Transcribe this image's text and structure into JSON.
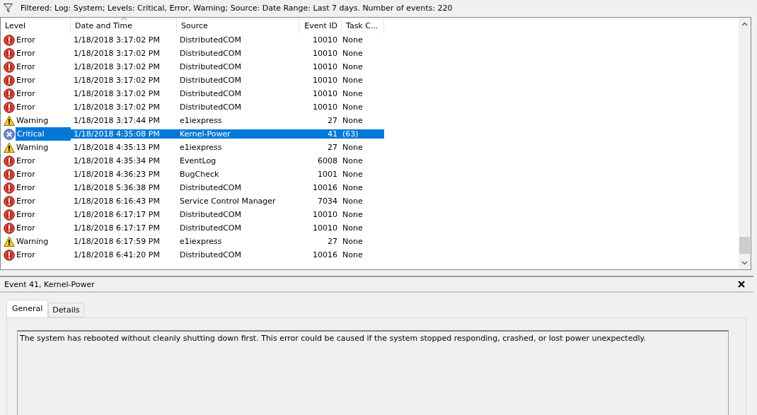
{
  "filter_bar": {
    "text": "Filtered: Log: System; Levels: Critical, Error, Warning; Source: Date Range: Last 7 days. Number of events: 220"
  },
  "table": {
    "columns": [
      {
        "label": "Level",
        "sorted": false
      },
      {
        "label": "Date and Time",
        "sorted": true
      },
      {
        "label": "Source",
        "sorted": false
      },
      {
        "label": "Event ID",
        "sorted": false
      },
      {
        "label": "Task C...",
        "sorted": false
      }
    ],
    "rows": [
      {
        "kind": "error",
        "level": "Error",
        "date": "1/18/2018 3:17:02 PM",
        "source": "DistributedCOM",
        "event_id": "10010",
        "task": "None",
        "selected": false
      },
      {
        "kind": "error",
        "level": "Error",
        "date": "1/18/2018 3:17:02 PM",
        "source": "DistributedCOM",
        "event_id": "10010",
        "task": "None",
        "selected": false
      },
      {
        "kind": "error",
        "level": "Error",
        "date": "1/18/2018 3:17:02 PM",
        "source": "DistributedCOM",
        "event_id": "10010",
        "task": "None",
        "selected": false
      },
      {
        "kind": "error",
        "level": "Error",
        "date": "1/18/2018 3:17:02 PM",
        "source": "DistributedCOM",
        "event_id": "10010",
        "task": "None",
        "selected": false
      },
      {
        "kind": "error",
        "level": "Error",
        "date": "1/18/2018 3:17:02 PM",
        "source": "DistributedCOM",
        "event_id": "10010",
        "task": "None",
        "selected": false
      },
      {
        "kind": "error",
        "level": "Error",
        "date": "1/18/2018 3:17:02 PM",
        "source": "DistributedCOM",
        "event_id": "10010",
        "task": "None",
        "selected": false
      },
      {
        "kind": "warning",
        "level": "Warning",
        "date": "1/18/2018 3:17:44 PM",
        "source": "e1iexpress",
        "event_id": "27",
        "task": "None",
        "selected": false
      },
      {
        "kind": "critical",
        "level": "Critical",
        "date": "1/18/2018 4:35:08 PM",
        "source": "Kernel-Power",
        "event_id": "41",
        "task": "(63)",
        "selected": true
      },
      {
        "kind": "warning",
        "level": "Warning",
        "date": "1/18/2018 4:35:13 PM",
        "source": "e1iexpress",
        "event_id": "27",
        "task": "None",
        "selected": false
      },
      {
        "kind": "error",
        "level": "Error",
        "date": "1/18/2018 4:35:34 PM",
        "source": "EventLog",
        "event_id": "6008",
        "task": "None",
        "selected": false
      },
      {
        "kind": "error",
        "level": "Error",
        "date": "1/18/2018 4:36:23 PM",
        "source": "BugCheck",
        "event_id": "1001",
        "task": "None",
        "selected": false
      },
      {
        "kind": "error",
        "level": "Error",
        "date": "1/18/2018 5:36:38 PM",
        "source": "DistributedCOM",
        "event_id": "10016",
        "task": "None",
        "selected": false
      },
      {
        "kind": "error",
        "level": "Error",
        "date": "1/18/2018 6:16:43 PM",
        "source": "Service Control Manager",
        "event_id": "7034",
        "task": "None",
        "selected": false
      },
      {
        "kind": "error",
        "level": "Error",
        "date": "1/18/2018 6:17:17 PM",
        "source": "DistributedCOM",
        "event_id": "10010",
        "task": "None",
        "selected": false
      },
      {
        "kind": "error",
        "level": "Error",
        "date": "1/18/2018 6:17:17 PM",
        "source": "DistributedCOM",
        "event_id": "10010",
        "task": "None",
        "selected": false
      },
      {
        "kind": "warning",
        "level": "Warning",
        "date": "1/18/2018 6:17:59 PM",
        "source": "e1iexpress",
        "event_id": "27",
        "task": "None",
        "selected": false
      },
      {
        "kind": "error",
        "level": "Error",
        "date": "1/18/2018 6:41:20 PM",
        "source": "DistributedCOM",
        "event_id": "10016",
        "task": "None",
        "selected": false
      }
    ]
  },
  "detail": {
    "title": "Event 41, Kernel-Power",
    "tabs": [
      {
        "label": "General",
        "selected": true
      },
      {
        "label": "Details",
        "selected": false
      }
    ],
    "description": "The system has rebooted without cleanly shutting down first. This error could be caused if the system stopped responding, crashed, or lost power unexpectedly."
  }
}
